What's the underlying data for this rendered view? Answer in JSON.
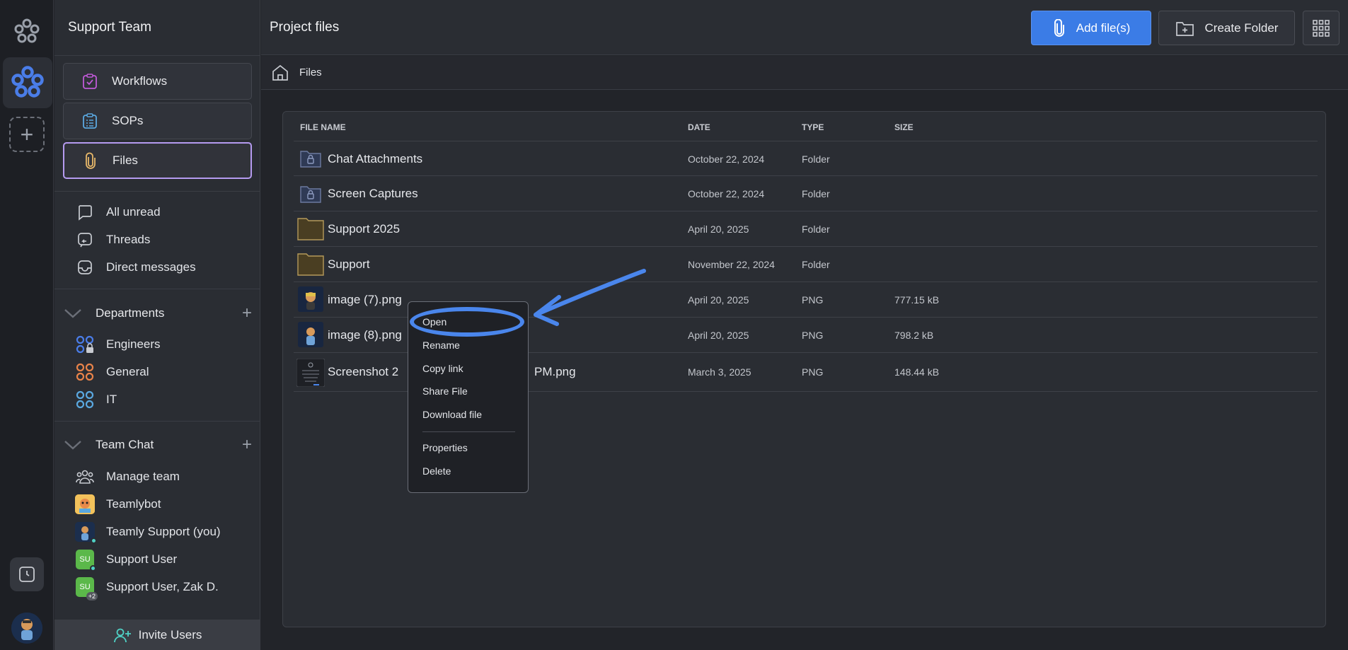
{
  "sidebar": {
    "title": "Support Team",
    "nav": [
      {
        "label": "Workflows"
      },
      {
        "label": "SOPs"
      },
      {
        "label": "Files"
      }
    ],
    "quick": [
      {
        "label": "All unread"
      },
      {
        "label": "Threads"
      },
      {
        "label": "Direct messages"
      }
    ],
    "departments": {
      "title": "Departments",
      "items": [
        {
          "label": "Engineers"
        },
        {
          "label": "General"
        },
        {
          "label": "IT"
        }
      ]
    },
    "team_chat": {
      "title": "Team Chat",
      "items": [
        {
          "label": "Manage team"
        },
        {
          "label": "Teamlybot"
        },
        {
          "label": "Teamly Support (you)"
        },
        {
          "label": "Support User",
          "initials": "SU"
        },
        {
          "label": "Support User, Zak D.",
          "initials": "SU",
          "badge": "+2"
        }
      ]
    },
    "invite_label": "Invite Users"
  },
  "header": {
    "title": "Project files",
    "add_files_label": "Add file(s)",
    "create_folder_label": "Create Folder"
  },
  "breadcrumb": {
    "current": "Files"
  },
  "table": {
    "columns": [
      "FILE NAME",
      "DATE",
      "TYPE",
      "SIZE"
    ],
    "rows": [
      {
        "name": "Chat Attachments",
        "date": "October 22, 2024",
        "type": "Folder",
        "size": "",
        "icon": "locked-folder-icon"
      },
      {
        "name": "Screen Captures",
        "date": "October 22, 2024",
        "type": "Folder",
        "size": "",
        "icon": "locked-folder-icon"
      },
      {
        "name": "Support 2025",
        "date": "April 20, 2025",
        "type": "Folder",
        "size": "",
        "icon": "folder-icon"
      },
      {
        "name": "Support",
        "date": "November 22, 2024",
        "type": "Folder",
        "size": "",
        "icon": "folder-icon"
      },
      {
        "name": "image (7).png",
        "date": "April 20, 2025",
        "type": "PNG",
        "size": "777.15 kB",
        "icon": "image-thumbnail"
      },
      {
        "name": "image (8).png",
        "date": "April 20, 2025",
        "type": "PNG",
        "size": "798.2 kB",
        "icon": "image-thumbnail"
      },
      {
        "name_start": "Screenshot 2",
        "name_end": "PM.png",
        "date": "March 3, 2025",
        "type": "PNG",
        "size": "148.44 kB",
        "icon": "screenshot-thumbnail"
      }
    ]
  },
  "context_menu": {
    "items": [
      "Open",
      "Rename",
      "Copy link",
      "Share File",
      "Download file"
    ],
    "items_after_separator": [
      "Properties",
      "Delete"
    ]
  },
  "colors": {
    "accent": "#3b7ce6",
    "active_border": "#b59bf0",
    "annotation": "#4a86ec"
  }
}
